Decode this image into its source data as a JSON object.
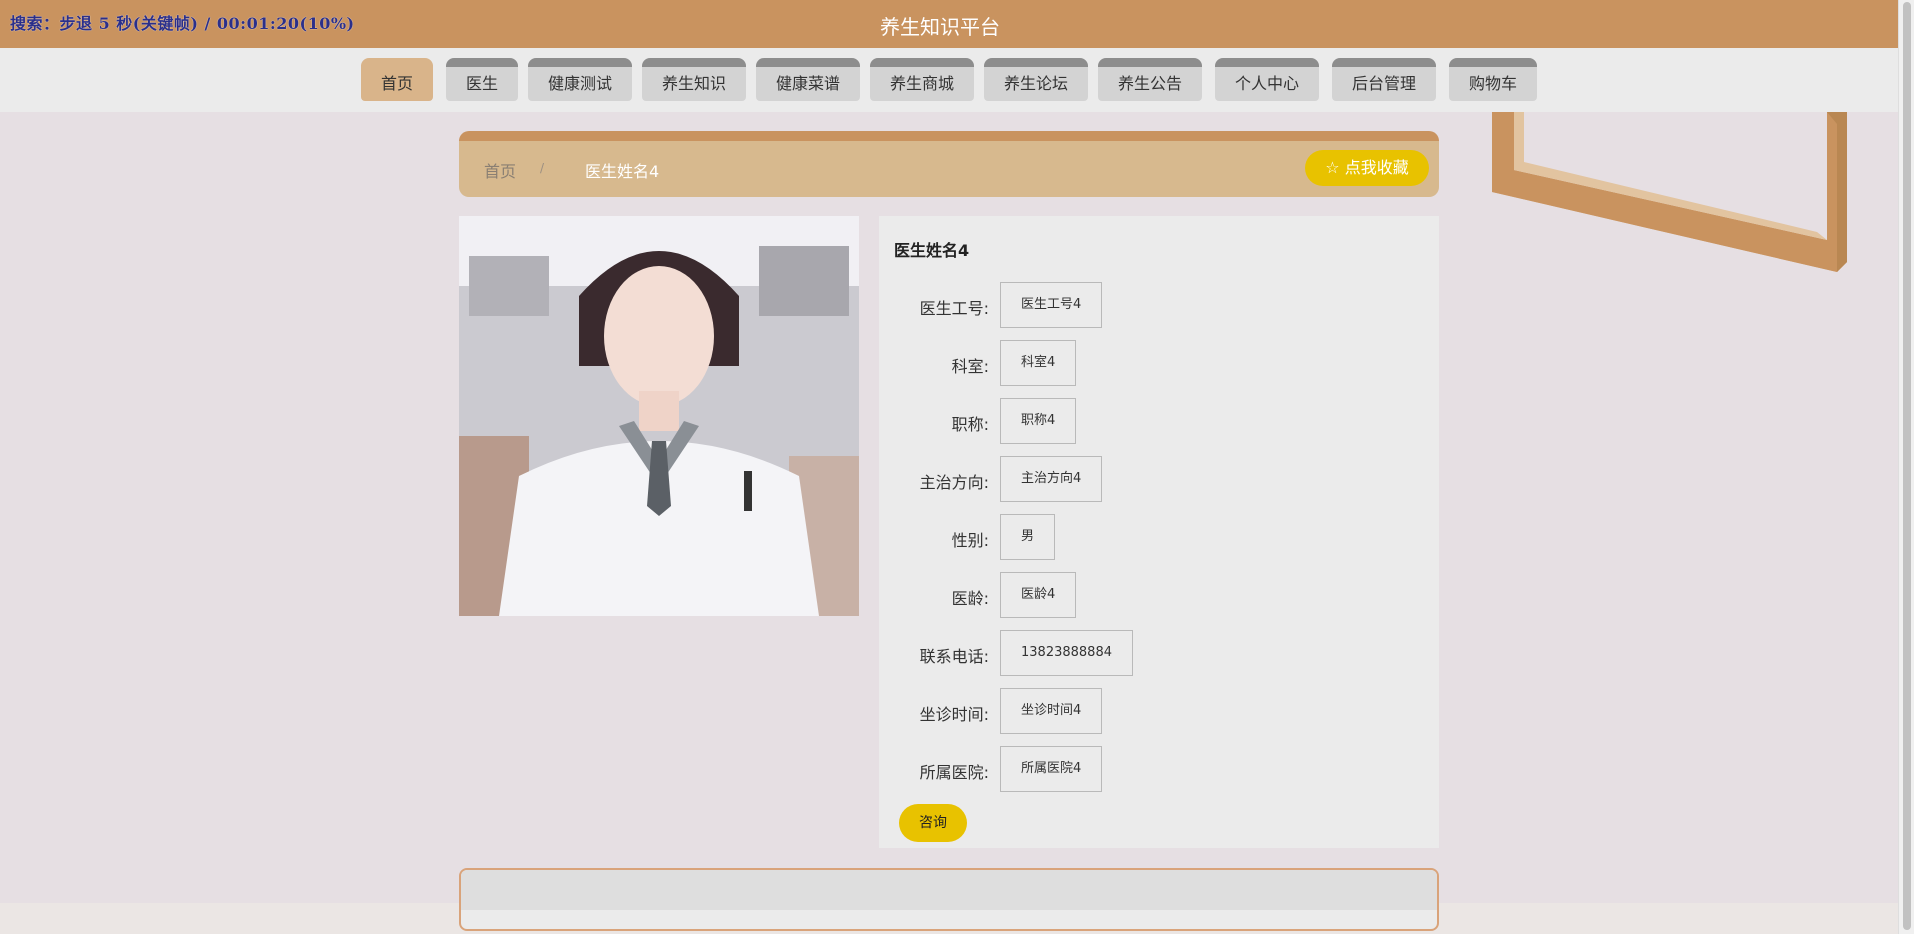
{
  "overlay": {
    "status": "搜索：步退 5 秒(关键帧) / 00:01:20(10%)"
  },
  "header": {
    "title": "养生知识平台"
  },
  "nav": {
    "items": [
      {
        "label": "首页",
        "active": true
      },
      {
        "label": "医生"
      },
      {
        "label": "健康测试"
      },
      {
        "label": "养生知识"
      },
      {
        "label": "健康菜谱"
      },
      {
        "label": "养生商城"
      },
      {
        "label": "养生论坛"
      },
      {
        "label": "养生公告"
      },
      {
        "label": "个人中心"
      },
      {
        "label": "后台管理"
      },
      {
        "label": "购物车"
      }
    ]
  },
  "breadcrumb": {
    "home": "首页",
    "separator": "/",
    "current": "医生姓名4"
  },
  "favorite_button": {
    "icon": "star-outline-icon",
    "label": "点我收藏"
  },
  "doctor": {
    "name": "医生姓名4",
    "fields": [
      {
        "label": "医生工号:",
        "value": "医生工号4"
      },
      {
        "label": "科室:",
        "value": "科室4"
      },
      {
        "label": "职称:",
        "value": "职称4"
      },
      {
        "label": "主治方向:",
        "value": "主治方向4"
      },
      {
        "label": "性别:",
        "value": "男"
      },
      {
        "label": "医龄:",
        "value": "医龄4"
      },
      {
        "label": "联系电话:",
        "value": "13823888884"
      },
      {
        "label": "坐诊时间:",
        "value": "坐诊时间4"
      },
      {
        "label": "所属医院:",
        "value": "所属医院4"
      }
    ]
  },
  "consult_button": {
    "label": "咨询"
  },
  "colors": {
    "brand": "#c9935f",
    "accent": "#e8c200",
    "nav_active": "#d9b48a"
  }
}
